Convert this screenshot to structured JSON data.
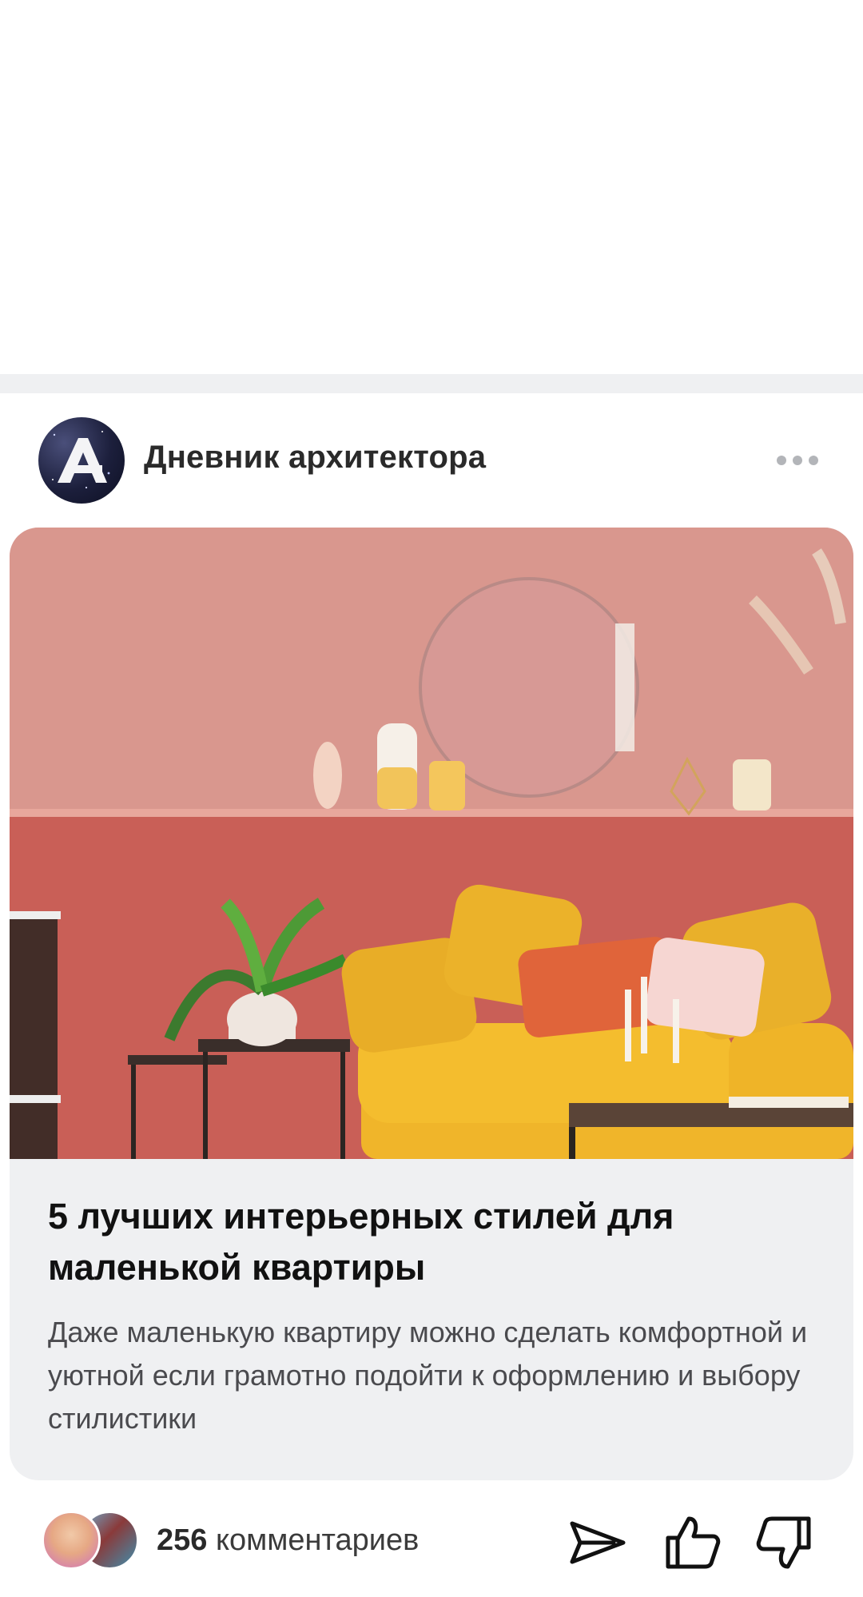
{
  "channel": {
    "name": "Дневник архитектора",
    "avatar_icon": "channel-logo-a-icon",
    "more_icon": "more-dots-icon"
  },
  "article": {
    "title": "5 лучших интерьерных стилей для маленькой квартиры",
    "subtitle": "Даже маленькую квартиру можно сделать комфортной и уютной если грамотно подойти к оформлению и выбору стилистики",
    "image_description_icon": "article-cover-image"
  },
  "footer": {
    "comments_count": "256",
    "comments_label": "комментариев",
    "share_icon": "share-icon",
    "like_icon": "thumbs-up-icon",
    "dislike_icon": "thumbs-down-icon"
  },
  "colors": {
    "background": "#ffffff",
    "divider": "#eff0f2",
    "card_bg": "#eff0f2",
    "wall_upper": "#d58f87",
    "wall_lower": "#c95f57",
    "sofa": "#f0b52a"
  }
}
